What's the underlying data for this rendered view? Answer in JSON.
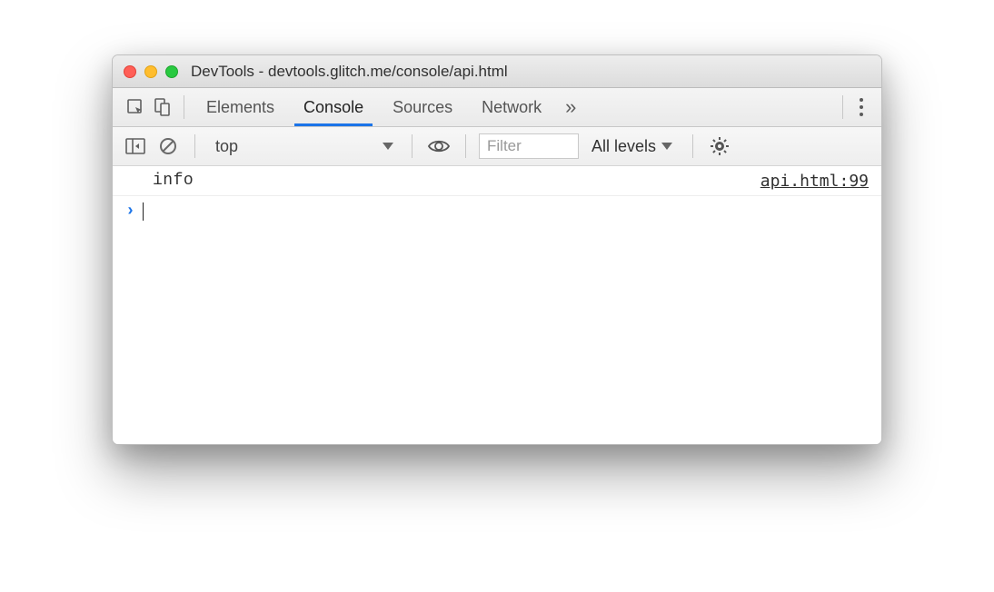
{
  "window": {
    "title": "DevTools - devtools.glitch.me/console/api.html"
  },
  "tabs": {
    "elements": "Elements",
    "console": "Console",
    "sources": "Sources",
    "network": "Network"
  },
  "filter": {
    "context": "top",
    "filter_placeholder": "Filter",
    "levels": "All levels"
  },
  "log": {
    "message": "info",
    "source": "api.html:99"
  }
}
